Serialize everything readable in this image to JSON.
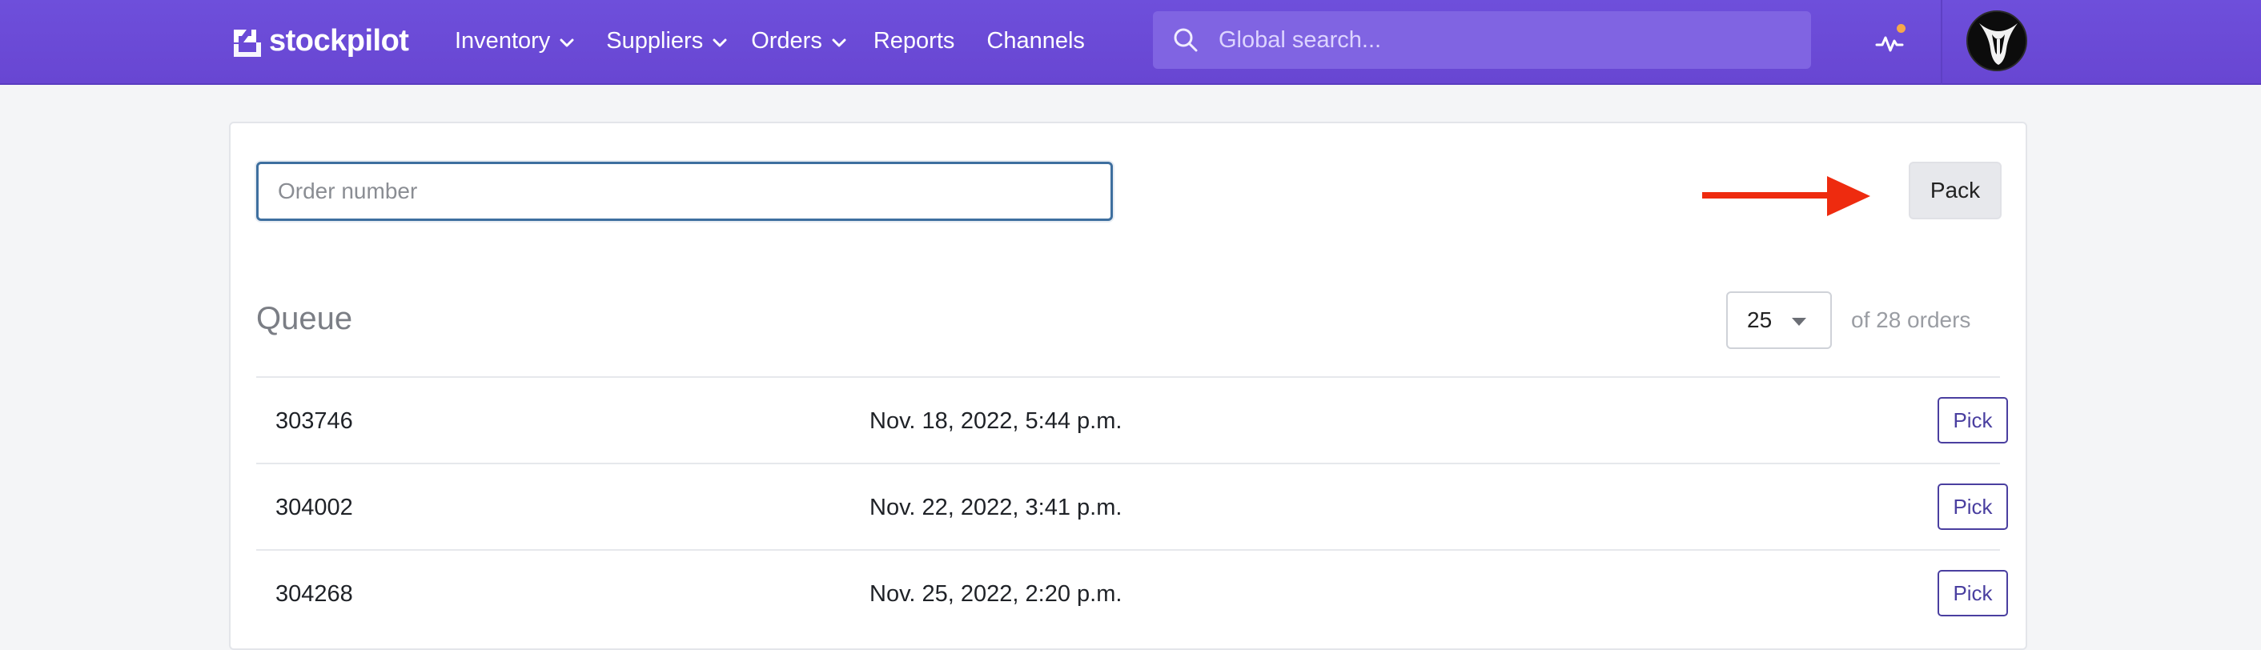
{
  "brand": {
    "name": "stockpilot",
    "logo_icon": "stockpilot-logo-icon"
  },
  "nav": {
    "items": [
      {
        "label": "Inventory",
        "has_dropdown": true
      },
      {
        "label": "Suppliers",
        "has_dropdown": true
      },
      {
        "label": "Orders",
        "has_dropdown": true
      },
      {
        "label": "Reports",
        "has_dropdown": false
      },
      {
        "label": "Channels",
        "has_dropdown": false
      }
    ]
  },
  "search": {
    "placeholder": "Global search...",
    "value": "",
    "icon": "search-icon"
  },
  "activity": {
    "icon": "activity-pulse-icon",
    "has_notification": true
  },
  "user": {
    "avatar": "user-avatar"
  },
  "colors": {
    "nav_bg": "#6c4bd8",
    "accent": "#4a3fa0",
    "arrow": "#ee2b0f",
    "notification_dot": "#f7a84a",
    "input_focus": "#3e6f9f"
  },
  "order_form": {
    "placeholder": "Order number",
    "value": "",
    "pack_label": "Pack"
  },
  "queue": {
    "title": "Queue",
    "per_page": "25",
    "total_label": "of 28 orders",
    "rows": [
      {
        "order": "303746",
        "date": "Nov. 18, 2022, 5:44 p.m.",
        "action": "Pick"
      },
      {
        "order": "304002",
        "date": "Nov. 22, 2022, 3:41 p.m.",
        "action": "Pick"
      },
      {
        "order": "304268",
        "date": "Nov. 25, 2022, 2:20 p.m.",
        "action": "Pick"
      }
    ]
  }
}
